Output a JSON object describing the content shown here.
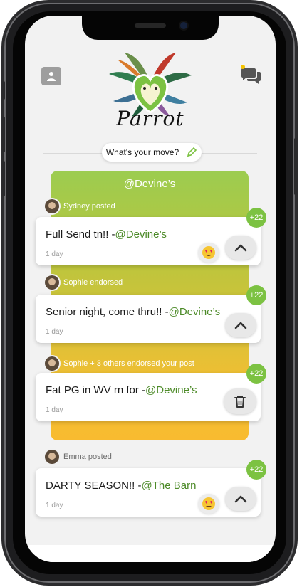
{
  "app": {
    "name": "Parrot"
  },
  "header": {
    "compose_placeholder": "What's your move?"
  },
  "venue": {
    "name": "@Devine’s"
  },
  "feed": [
    {
      "meta": "Sydney posted",
      "text": "Full Send tn!! -",
      "mention": "@Devine’s",
      "time": "1 day",
      "score": "+22",
      "reaction": "heart-eyes"
    },
    {
      "meta": "Sophie endorsed",
      "text": "Senior night, come thru!! -",
      "mention": "@Devine’s",
      "time": "1 day",
      "score": "+22"
    },
    {
      "meta": "Sophie + 3 others endorsed your post",
      "text": "Fat PG in WV rn for  -",
      "mention": "@Devine’s",
      "time": "1 day",
      "score": "+22"
    },
    {
      "meta": "Emma posted",
      "text": "DARTY SEASON!! -",
      "mention": "@The Barn",
      "time": "1 day",
      "score": "+22",
      "reaction": "heart-eyes"
    }
  ],
  "colors": {
    "accent": "#7cc242",
    "mention": "#4c8a28",
    "venue_gradient_top": "#9ccc50",
    "venue_gradient_bottom": "#f8bb30"
  },
  "icons": [
    "profile-icon",
    "chat-icon",
    "pencil-icon",
    "upvote-chevron-icon",
    "trash-icon",
    "heart-eyes-emoji-icon"
  ]
}
